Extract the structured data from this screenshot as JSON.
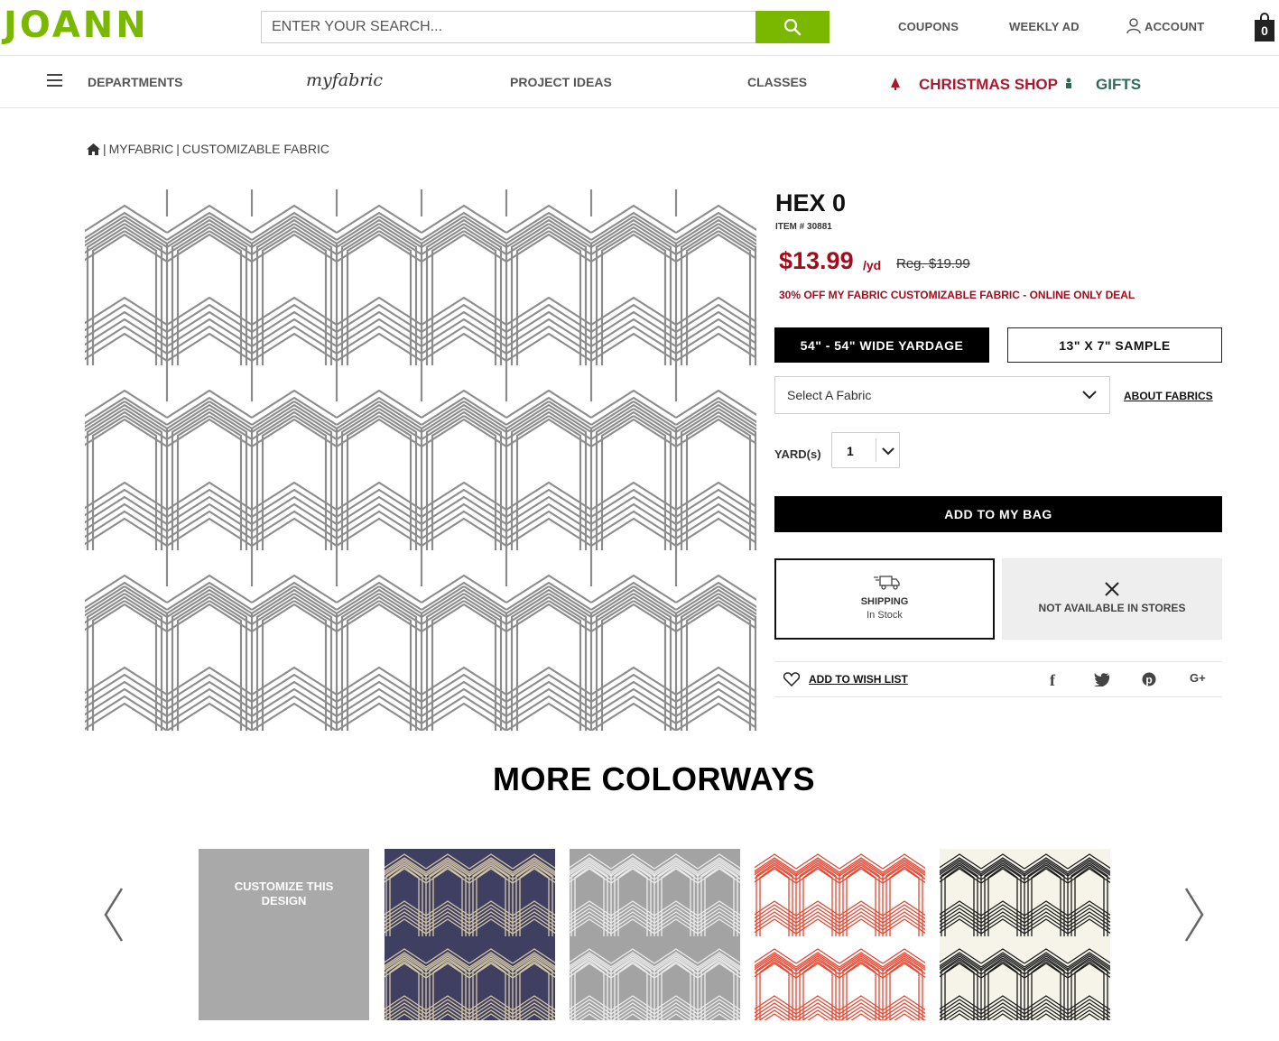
{
  "header": {
    "logo": "JOANN",
    "search_placeholder": "ENTER YOUR SEARCH...",
    "coupons": "COUPONS",
    "weekly_ad": "WEEKLY AD",
    "account": "ACCOUNT",
    "bag_count": "0"
  },
  "nav": {
    "departments": "DEPARTMENTS",
    "myfabric": "myfabric",
    "project_ideas": "PROJECT IDEAS",
    "classes": "CLASSES",
    "christmas_shop": "CHRISTMAS SHOP",
    "gifts": "GIFTS"
  },
  "breadcrumb": {
    "items": [
      "MYFABRIC",
      "CUSTOMIZABLE FABRIC"
    ],
    "separator": "|"
  },
  "product": {
    "title": "HEX 0",
    "item_number": "ITEM # 30881",
    "price": "$13.99",
    "unit": "/yd",
    "regular_price": "Reg. $19.99",
    "promo": "30% OFF MY FABRIC CUSTOMIZABLE FABRIC - ONLINE ONLY DEAL",
    "options": [
      "54\" - 54\" WIDE YARDAGE",
      "13\" X 7\" SAMPLE"
    ],
    "select_fabric": "Select A Fabric",
    "about_fabrics": "ABOUT FABRICS",
    "yard_label": "YARD(s)",
    "quantity": "1",
    "add_to_bag": "ADD TO MY BAG",
    "shipping_title": "SHIPPING",
    "shipping_status": "In Stock",
    "store_status": "NOT AVAILABLE IN STORES",
    "wish_list": "ADD TO WISH LIST",
    "social": {
      "facebook": "f",
      "googleplus": "G+"
    }
  },
  "colorways": {
    "title": "MORE COLORWAYS",
    "customize": "CUSTOMIZE THIS DESIGN",
    "swatches": [
      {
        "bg": "#3e3f61",
        "line": "#d7c9a6"
      },
      {
        "bg": "#a3a3a3",
        "line": "#ededed"
      },
      {
        "bg": "#ffffff",
        "line": "#e6442e"
      },
      {
        "bg": "#f6f3e9",
        "line": "#1a1a1a"
      }
    ]
  },
  "colors": {
    "brand_green": "#7ab800",
    "sale_red": "#a10d1c",
    "christmas_red": "#a8192e",
    "gifts_green": "#2e6a5a",
    "pattern_line": "#8c8c8c"
  }
}
